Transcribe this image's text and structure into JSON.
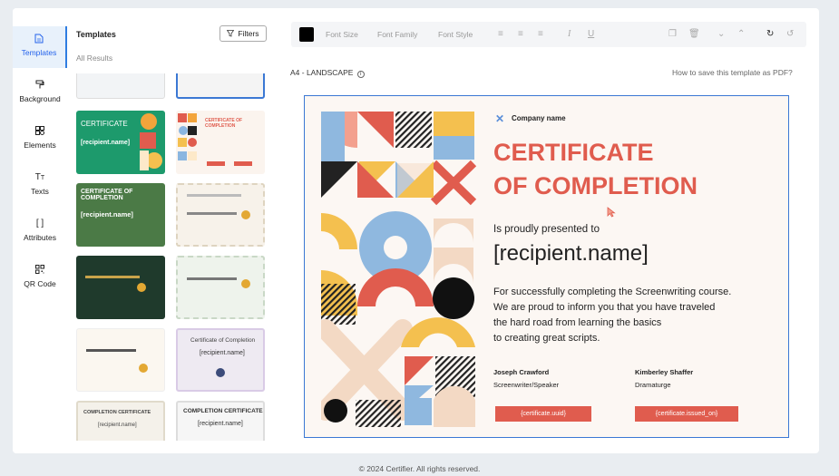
{
  "sidebar": {
    "items": [
      {
        "label": "Templates",
        "icon": "file-icon"
      },
      {
        "label": "Background",
        "icon": "paint-roller-icon"
      },
      {
        "label": "Elements",
        "icon": "shapes-icon"
      },
      {
        "label": "Texts",
        "icon": "text-icon"
      },
      {
        "label": "Attributes",
        "icon": "brackets-icon"
      },
      {
        "label": "QR Code",
        "icon": "qr-code-icon"
      }
    ]
  },
  "templates_panel": {
    "title": "Templates",
    "filters_label": "Filters",
    "subtitle": "All Results",
    "thumb_texts": {
      "t1_title": "CERTIFICATE",
      "t1_recipient": "[recipient.name]",
      "t2_title": "CERTIFICATE OF COMPLETION",
      "t3_title": "CERTIFICATE OF COMPLETION",
      "t3_recipient": "[recipient.name]",
      "t8_title": "Certificate of Completion",
      "t8_recipient": "[recipient.name]",
      "t9_title": "COMPLETION CERTIFICATE",
      "t9_recipient": "[recipient.name]",
      "t10_title": "COMPLETION CERTIFICATE",
      "t10_recipient": "[recipient.name]"
    }
  },
  "toolbar": {
    "font_size": "Font Size",
    "font_family": "Font Family",
    "font_style": "Font Style",
    "color": "#000000"
  },
  "canvas": {
    "size_label": "A4 - LANDSCAPE",
    "howto_link": "How to save this template as PDF?"
  },
  "certificate": {
    "company": "Company name",
    "title_line1": "CERTIFICATE",
    "title_line2": "OF COMPLETION",
    "presented": "Is proudly presented to",
    "recipient": "[recipient.name]",
    "body": [
      "For successfully completing the Screenwriting course.",
      "We are proud to inform you that you have traveled",
      "the hard road from learning the basics",
      "to creating great scripts."
    ],
    "signers": [
      {
        "name": "Joseph Crawford",
        "role": "Screenwriter/Speaker"
      },
      {
        "name": "Kimberley Shaffer",
        "role": "Dramaturge"
      }
    ],
    "field1": "{certificate.uuid}",
    "field2": "{certificate.issued_on}",
    "accent": "#e05c4e"
  },
  "footer": "© 2024 Certifier. All rights reserved."
}
